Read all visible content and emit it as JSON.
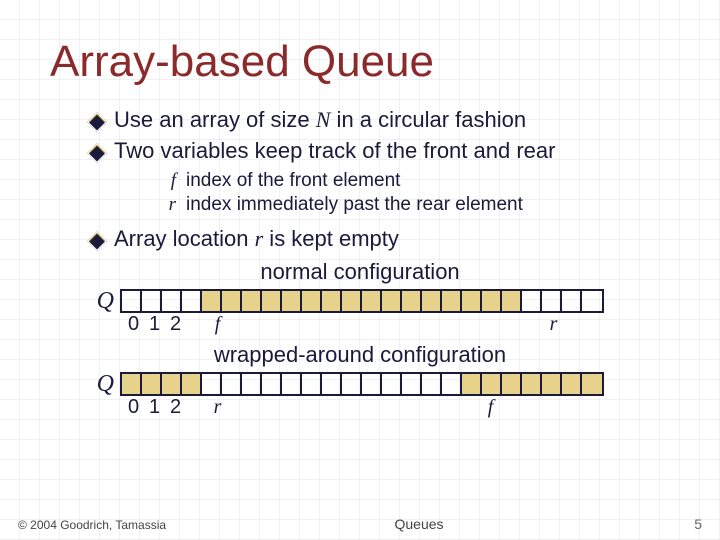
{
  "slide": {
    "title": "Array-based Queue",
    "bullets": {
      "b1_pre": "Use an array of size ",
      "b1_var": "N",
      "b1_post": " in a circular fashion",
      "b2": "Two variables keep track of the front and rear",
      "b3_pre": "Array location ",
      "b3_var": "r",
      "b3_post": " is kept empty"
    },
    "sub": {
      "f_var": "f",
      "f_text": "index of the front element",
      "r_var": "r",
      "r_text": "index immediately past the rear element"
    },
    "captions": {
      "normal": "normal configuration",
      "wrapped": "wrapped-around configuration"
    },
    "markers": {
      "m0": "0",
      "m1": "1",
      "m2": "2",
      "f": "f",
      "r": "r"
    },
    "q_label": "Q"
  },
  "footer": {
    "copyright": "© 2004 Goodrich, Tamassia",
    "center": "Queues",
    "page": "5"
  },
  "chart_data": [
    {
      "type": "table",
      "title": "normal configuration",
      "n_cells": 24,
      "filled_indices": [
        4,
        5,
        6,
        7,
        8,
        9,
        10,
        11,
        12,
        13,
        14,
        15,
        16,
        17,
        18,
        19
      ],
      "labels": {
        "0": "0",
        "1": "1",
        "2": "2",
        "4": "f",
        "20": "r"
      },
      "note": "filled cells = elements between f and r (r exclusive)"
    },
    {
      "type": "table",
      "title": "wrapped-around configuration",
      "n_cells": 24,
      "filled_indices": [
        0,
        1,
        2,
        3,
        17,
        18,
        19,
        20,
        21,
        22,
        23
      ],
      "labels": {
        "0": "0",
        "1": "1",
        "2": "2",
        "4": "r",
        "17": "f"
      },
      "note": "filled cells wrap past end back to start; r exclusive"
    }
  ]
}
